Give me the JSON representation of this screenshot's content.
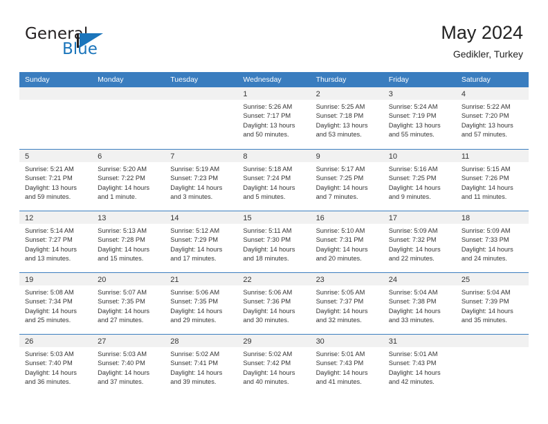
{
  "brand": {
    "name_part1": "General",
    "name_part2": "Blue",
    "triangle_color": "#1b75bb"
  },
  "header": {
    "title": "May 2024",
    "subtitle": "Gedikler, Turkey"
  },
  "theme": {
    "header_blue": "#3a7dbf",
    "daynum_band": "#f1f1f1",
    "text": "#333333"
  },
  "weekday_headers": [
    "Sunday",
    "Monday",
    "Tuesday",
    "Wednesday",
    "Thursday",
    "Friday",
    "Saturday"
  ],
  "labels": {
    "sunrise": "Sunrise:",
    "sunset": "Sunset:",
    "daylight": "Daylight:"
  },
  "weeks": [
    [
      {
        "day": "",
        "empty": true
      },
      {
        "day": "",
        "empty": true
      },
      {
        "day": "",
        "empty": true
      },
      {
        "day": "1",
        "sunrise": "Sunrise: 5:26 AM",
        "sunset": "Sunset: 7:17 PM",
        "daylight1": "Daylight: 13 hours",
        "daylight2": "and 50 minutes."
      },
      {
        "day": "2",
        "sunrise": "Sunrise: 5:25 AM",
        "sunset": "Sunset: 7:18 PM",
        "daylight1": "Daylight: 13 hours",
        "daylight2": "and 53 minutes."
      },
      {
        "day": "3",
        "sunrise": "Sunrise: 5:24 AM",
        "sunset": "Sunset: 7:19 PM",
        "daylight1": "Daylight: 13 hours",
        "daylight2": "and 55 minutes."
      },
      {
        "day": "4",
        "sunrise": "Sunrise: 5:22 AM",
        "sunset": "Sunset: 7:20 PM",
        "daylight1": "Daylight: 13 hours",
        "daylight2": "and 57 minutes."
      }
    ],
    [
      {
        "day": "5",
        "sunrise": "Sunrise: 5:21 AM",
        "sunset": "Sunset: 7:21 PM",
        "daylight1": "Daylight: 13 hours",
        "daylight2": "and 59 minutes."
      },
      {
        "day": "6",
        "sunrise": "Sunrise: 5:20 AM",
        "sunset": "Sunset: 7:22 PM",
        "daylight1": "Daylight: 14 hours",
        "daylight2": "and 1 minute."
      },
      {
        "day": "7",
        "sunrise": "Sunrise: 5:19 AM",
        "sunset": "Sunset: 7:23 PM",
        "daylight1": "Daylight: 14 hours",
        "daylight2": "and 3 minutes."
      },
      {
        "day": "8",
        "sunrise": "Sunrise: 5:18 AM",
        "sunset": "Sunset: 7:24 PM",
        "daylight1": "Daylight: 14 hours",
        "daylight2": "and 5 minutes."
      },
      {
        "day": "9",
        "sunrise": "Sunrise: 5:17 AM",
        "sunset": "Sunset: 7:25 PM",
        "daylight1": "Daylight: 14 hours",
        "daylight2": "and 7 minutes."
      },
      {
        "day": "10",
        "sunrise": "Sunrise: 5:16 AM",
        "sunset": "Sunset: 7:25 PM",
        "daylight1": "Daylight: 14 hours",
        "daylight2": "and 9 minutes."
      },
      {
        "day": "11",
        "sunrise": "Sunrise: 5:15 AM",
        "sunset": "Sunset: 7:26 PM",
        "daylight1": "Daylight: 14 hours",
        "daylight2": "and 11 minutes."
      }
    ],
    [
      {
        "day": "12",
        "sunrise": "Sunrise: 5:14 AM",
        "sunset": "Sunset: 7:27 PM",
        "daylight1": "Daylight: 14 hours",
        "daylight2": "and 13 minutes."
      },
      {
        "day": "13",
        "sunrise": "Sunrise: 5:13 AM",
        "sunset": "Sunset: 7:28 PM",
        "daylight1": "Daylight: 14 hours",
        "daylight2": "and 15 minutes."
      },
      {
        "day": "14",
        "sunrise": "Sunrise: 5:12 AM",
        "sunset": "Sunset: 7:29 PM",
        "daylight1": "Daylight: 14 hours",
        "daylight2": "and 17 minutes."
      },
      {
        "day": "15",
        "sunrise": "Sunrise: 5:11 AM",
        "sunset": "Sunset: 7:30 PM",
        "daylight1": "Daylight: 14 hours",
        "daylight2": "and 18 minutes."
      },
      {
        "day": "16",
        "sunrise": "Sunrise: 5:10 AM",
        "sunset": "Sunset: 7:31 PM",
        "daylight1": "Daylight: 14 hours",
        "daylight2": "and 20 minutes."
      },
      {
        "day": "17",
        "sunrise": "Sunrise: 5:09 AM",
        "sunset": "Sunset: 7:32 PM",
        "daylight1": "Daylight: 14 hours",
        "daylight2": "and 22 minutes."
      },
      {
        "day": "18",
        "sunrise": "Sunrise: 5:09 AM",
        "sunset": "Sunset: 7:33 PM",
        "daylight1": "Daylight: 14 hours",
        "daylight2": "and 24 minutes."
      }
    ],
    [
      {
        "day": "19",
        "sunrise": "Sunrise: 5:08 AM",
        "sunset": "Sunset: 7:34 PM",
        "daylight1": "Daylight: 14 hours",
        "daylight2": "and 25 minutes."
      },
      {
        "day": "20",
        "sunrise": "Sunrise: 5:07 AM",
        "sunset": "Sunset: 7:35 PM",
        "daylight1": "Daylight: 14 hours",
        "daylight2": "and 27 minutes."
      },
      {
        "day": "21",
        "sunrise": "Sunrise: 5:06 AM",
        "sunset": "Sunset: 7:35 PM",
        "daylight1": "Daylight: 14 hours",
        "daylight2": "and 29 minutes."
      },
      {
        "day": "22",
        "sunrise": "Sunrise: 5:06 AM",
        "sunset": "Sunset: 7:36 PM",
        "daylight1": "Daylight: 14 hours",
        "daylight2": "and 30 minutes."
      },
      {
        "day": "23",
        "sunrise": "Sunrise: 5:05 AM",
        "sunset": "Sunset: 7:37 PM",
        "daylight1": "Daylight: 14 hours",
        "daylight2": "and 32 minutes."
      },
      {
        "day": "24",
        "sunrise": "Sunrise: 5:04 AM",
        "sunset": "Sunset: 7:38 PM",
        "daylight1": "Daylight: 14 hours",
        "daylight2": "and 33 minutes."
      },
      {
        "day": "25",
        "sunrise": "Sunrise: 5:04 AM",
        "sunset": "Sunset: 7:39 PM",
        "daylight1": "Daylight: 14 hours",
        "daylight2": "and 35 minutes."
      }
    ],
    [
      {
        "day": "26",
        "sunrise": "Sunrise: 5:03 AM",
        "sunset": "Sunset: 7:40 PM",
        "daylight1": "Daylight: 14 hours",
        "daylight2": "and 36 minutes."
      },
      {
        "day": "27",
        "sunrise": "Sunrise: 5:03 AM",
        "sunset": "Sunset: 7:40 PM",
        "daylight1": "Daylight: 14 hours",
        "daylight2": "and 37 minutes."
      },
      {
        "day": "28",
        "sunrise": "Sunrise: 5:02 AM",
        "sunset": "Sunset: 7:41 PM",
        "daylight1": "Daylight: 14 hours",
        "daylight2": "and 39 minutes."
      },
      {
        "day": "29",
        "sunrise": "Sunrise: 5:02 AM",
        "sunset": "Sunset: 7:42 PM",
        "daylight1": "Daylight: 14 hours",
        "daylight2": "and 40 minutes."
      },
      {
        "day": "30",
        "sunrise": "Sunrise: 5:01 AM",
        "sunset": "Sunset: 7:43 PM",
        "daylight1": "Daylight: 14 hours",
        "daylight2": "and 41 minutes."
      },
      {
        "day": "31",
        "sunrise": "Sunrise: 5:01 AM",
        "sunset": "Sunset: 7:43 PM",
        "daylight1": "Daylight: 14 hours",
        "daylight2": "and 42 minutes."
      },
      {
        "day": "",
        "empty": true
      }
    ]
  ]
}
